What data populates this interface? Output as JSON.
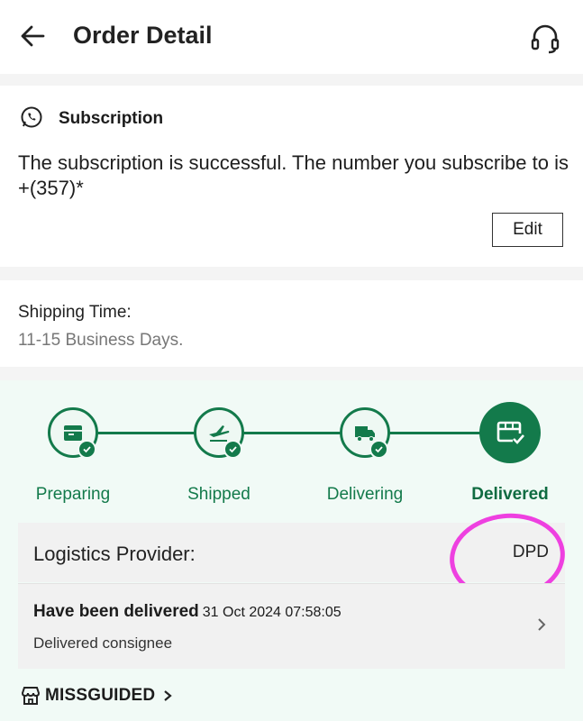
{
  "header": {
    "title": "Order Detail",
    "back_icon": "arrow-left-icon",
    "support_icon": "headset-icon"
  },
  "subscription": {
    "icon": "whatsapp-icon",
    "title": "Subscription",
    "message": "The subscription is successful. The number you subscribe to is +(357)*",
    "edit_label": "Edit"
  },
  "shipping": {
    "label": "Shipping Time:",
    "value": "11-15 Business Days."
  },
  "tracking": {
    "accent_color": "#137a4b",
    "steps": [
      {
        "label": "Preparing",
        "icon": "package-icon",
        "done": true
      },
      {
        "label": "Shipped",
        "icon": "airplane-icon",
        "done": true
      },
      {
        "label": "Delivering",
        "icon": "truck-icon",
        "done": true
      },
      {
        "label": "Delivered",
        "icon": "package-check-icon",
        "active": true
      }
    ],
    "logistics_label": "Logistics Provider:",
    "logistics_value": "DPD",
    "highlight_color": "#ee40e0",
    "latest_status": "Have been delivered",
    "latest_time": "31 Oct 2024 07:58:05",
    "latest_desc": "Delivered consignee"
  },
  "store": {
    "icon": "store-icon",
    "name": "MISSGUIDED"
  }
}
